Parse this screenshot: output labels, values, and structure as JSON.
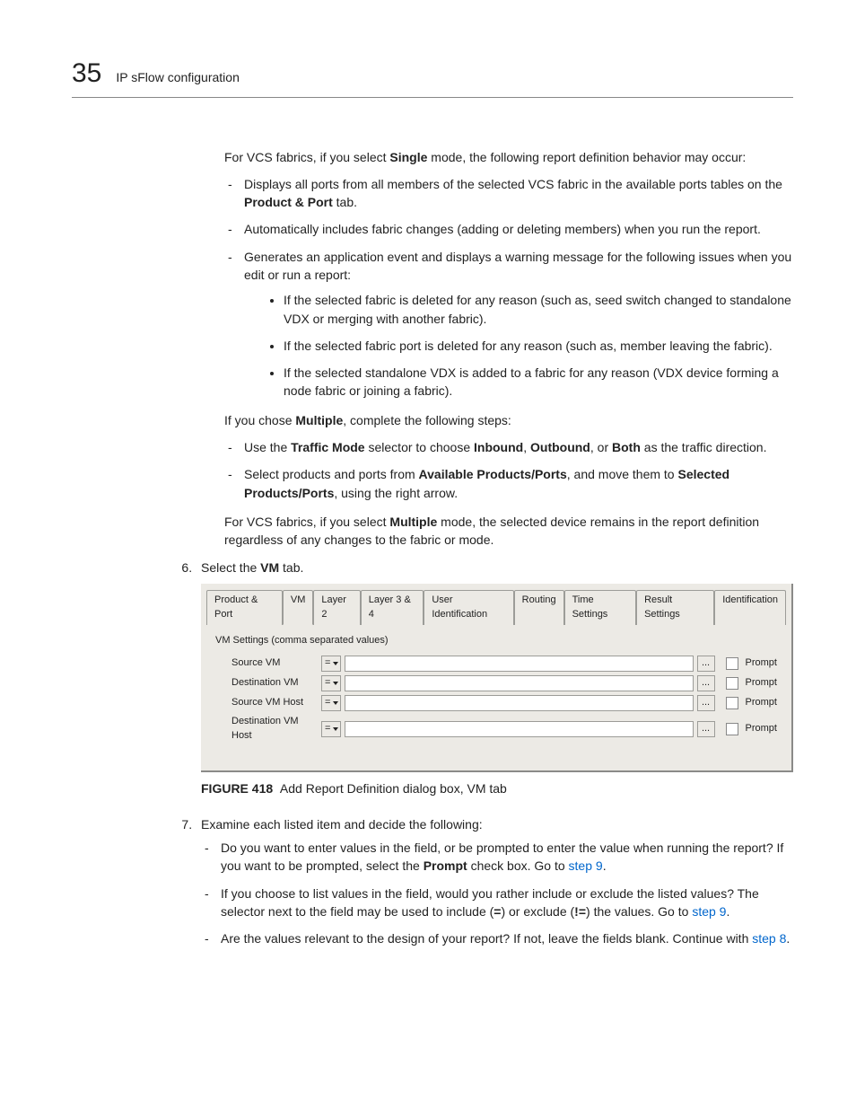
{
  "chapter": {
    "number": "35",
    "title": "IP sFlow configuration"
  },
  "para_vcs_single_intro": {
    "pre": "For VCS fabrics, if you select ",
    "b1": "Single",
    "post": " mode, the following report definition behavior may occur:"
  },
  "single_bullets": {
    "b1_pre": "Displays all ports from all members of the selected VCS fabric in the available ports tables on the ",
    "b1_bold": "Product & Port",
    "b1_post": " tab.",
    "b2": "Automatically includes fabric changes (adding or deleting members) when you run the report.",
    "b3": "Generates an application event and displays a warning message for the following issues when you edit or run a report:",
    "sub1": "If the selected fabric is deleted for any reason (such as, seed switch changed to standalone VDX or merging with another fabric).",
    "sub2": "If the selected fabric port is deleted for any reason (such as, member leaving the fabric).",
    "sub3": "If the selected standalone VDX is added to a fabric for any reason (VDX device forming a node fabric or joining a fabric)."
  },
  "multiple_intro": {
    "pre": "If you chose ",
    "b1": "Multiple",
    "post": ", complete the following steps:"
  },
  "multiple_bullets": {
    "b1_p1": "Use the ",
    "b1_b1": "Traffic Mode",
    "b1_p2": " selector to choose ",
    "b1_b2": "Inbound",
    "b1_c1": ", ",
    "b1_b3": "Outbound",
    "b1_c2": ", or ",
    "b1_b4": "Both",
    "b1_p3": " as the traffic direction.",
    "b2_p1": "Select products and ports from ",
    "b2_b1": "Available Products/Ports",
    "b2_p2": ", and move them to ",
    "b2_b2": "Selected Products/Ports",
    "b2_p3": ", using the right arrow."
  },
  "multiple_note": {
    "pre": "For VCS fabrics, if you select ",
    "b1": "Multiple",
    "post": " mode, the selected device remains in the report definition regardless of any changes to the fabric or mode."
  },
  "step6": {
    "pre": "Select the ",
    "b1": "VM",
    "post": " tab."
  },
  "dialog": {
    "tabs": [
      "Product & Port",
      "VM",
      "Layer 2",
      "Layer 3 & 4",
      "User Identification",
      "Routing",
      "Time Settings",
      "Result Settings",
      "Identification"
    ],
    "group_label": "VM Settings (comma separated values)",
    "rows": [
      {
        "label": "Source VM",
        "op": "="
      },
      {
        "label": "Destination VM",
        "op": "="
      },
      {
        "label": "Source VM Host",
        "op": "="
      },
      {
        "label": "Destination VM Host",
        "op": "="
      }
    ],
    "browse": "...",
    "prompt": "Prompt"
  },
  "figure": {
    "num": "FIGURE 418",
    "caption": "Add Report Definition dialog box, VM tab"
  },
  "step7": {
    "intro": "Examine each listed item and decide the following:",
    "b1_p1": "Do you want to enter values in the field, or be prompted to enter the value when running the report? If you want to be prompted, select the ",
    "b1_b1": "Prompt",
    "b1_p2": " check box. Go to ",
    "b1_link": "step 9",
    "b1_p3": ".",
    "b2_p1": "If you choose to list values in the field, would you rather include or exclude the listed values? The selector next to the field may be used to include (",
    "b2_b1": "=",
    "b2_p2": ") or exclude (",
    "b2_b2": "!=",
    "b2_p3": ") the values. Go to ",
    "b2_link": "step 9",
    "b2_p4": ".",
    "b3_p1": "Are the values relevant to the design of your report? If not, leave the fields blank. Continue with ",
    "b3_link": "step 8",
    "b3_p2": "."
  }
}
